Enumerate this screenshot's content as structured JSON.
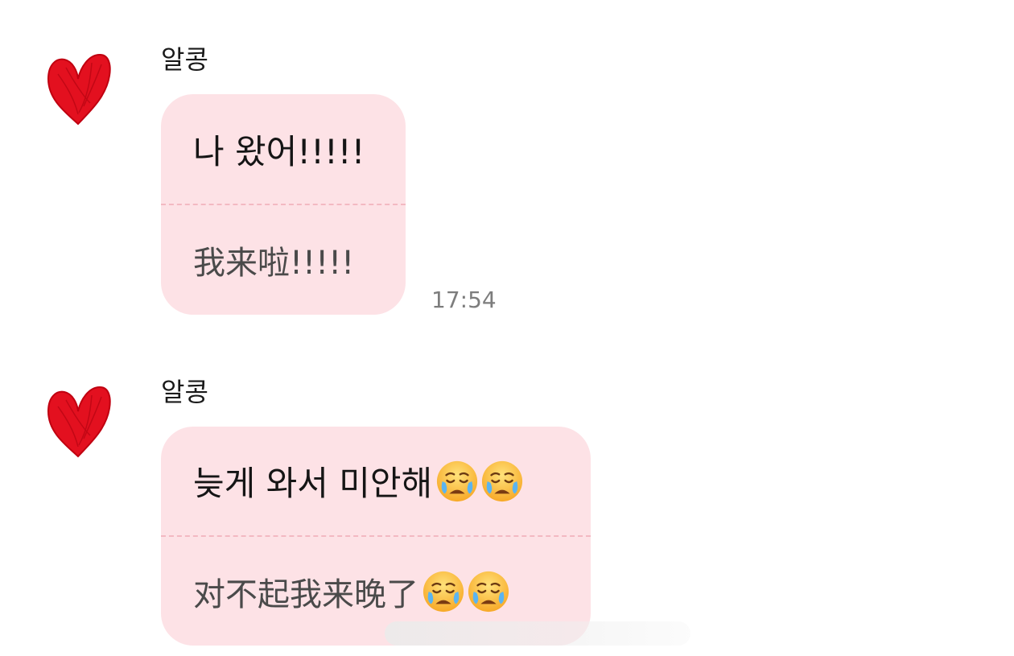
{
  "messages": [
    {
      "sender": "알콩",
      "original": "나 왔어!!!!!",
      "translation": "我来啦!!!!!",
      "time": "17:54",
      "emoji_count": 0
    },
    {
      "sender": "알콩",
      "original": "늦게 와서 미안해",
      "translation": "对不起我来晚了",
      "emoji": "crying-face-icon",
      "emoji_count": 2
    }
  ],
  "colors": {
    "bubble": "#fde2e6",
    "divider": "#f3b9c2",
    "heart": "#e3101f",
    "time": "#7d7d7d"
  }
}
